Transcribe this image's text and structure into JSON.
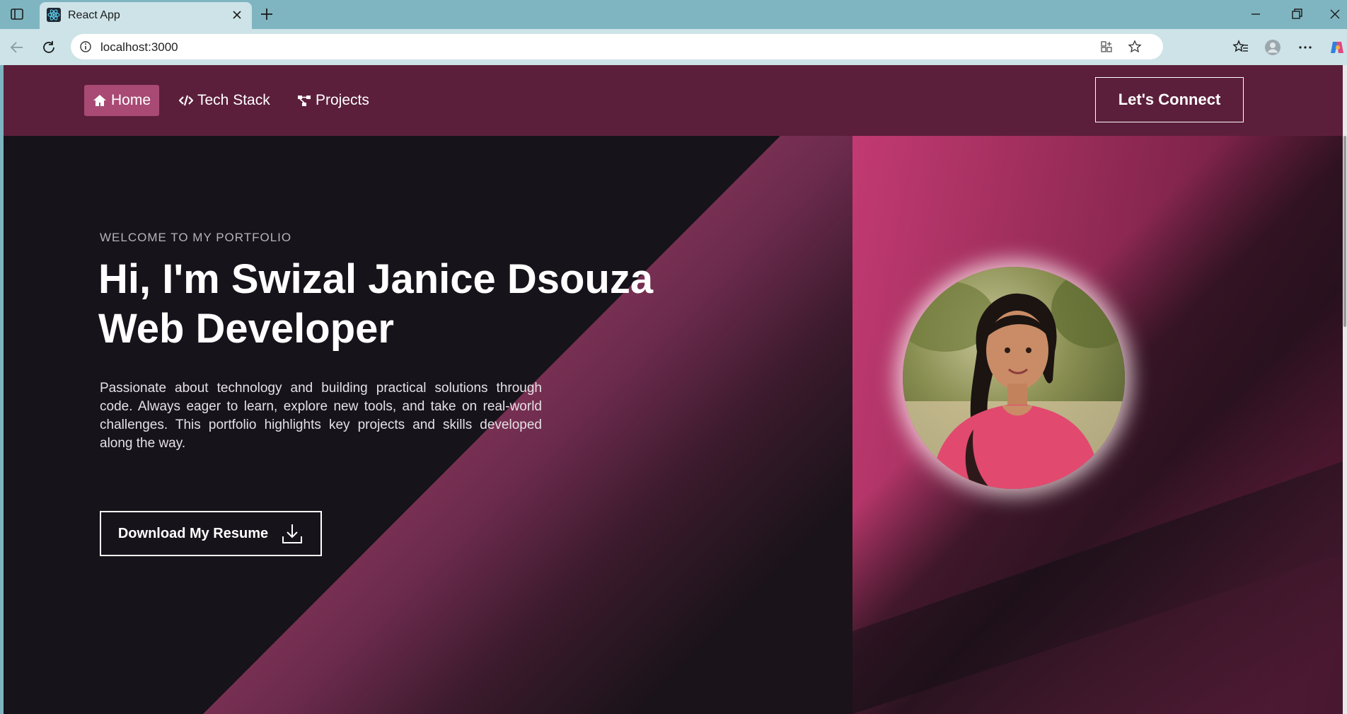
{
  "browser": {
    "tab_title": "React App",
    "url": "localhost:3000"
  },
  "nav": {
    "items": [
      {
        "label": "Home",
        "icon": "home-icon",
        "active": true
      },
      {
        "label": "Tech Stack",
        "icon": "code-icon",
        "active": false
      },
      {
        "label": "Projects",
        "icon": "project-diagram-icon",
        "active": false
      }
    ],
    "connect_label": "Let's Connect"
  },
  "hero": {
    "eyebrow": "WELCOME TO MY PORTFOLIO",
    "headline_line1": "Hi, I'm Swizal Janice Dsouza",
    "headline_line2": "Web Developer",
    "intro": "Passionate about technology and building practical solutions through code. Always eager to learn, explore new tools, and take on real-world challenges. This portfolio highlights key projects and skills developed along the way.",
    "resume_label": "Download My Resume"
  },
  "colors": {
    "navbar": "#5c1f3b",
    "accent_pink": "#c23a72",
    "active_nav": "#a84a74",
    "page_bg": "#16131a"
  }
}
